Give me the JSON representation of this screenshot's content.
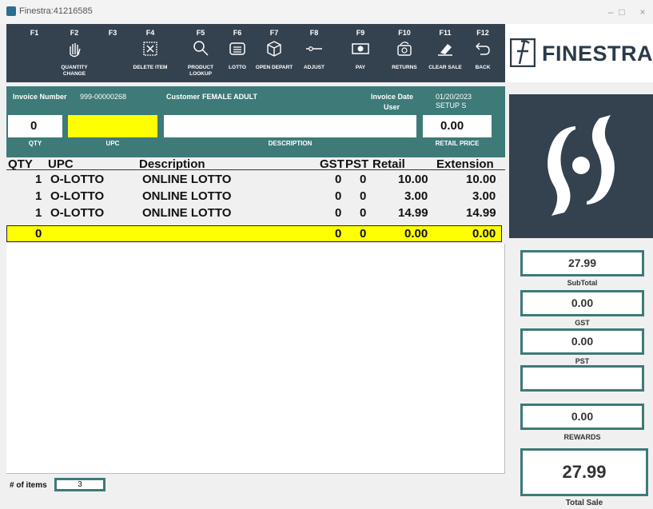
{
  "window": {
    "title": "Finestra:41216585",
    "minimize": "–",
    "maximize": "□",
    "close": "×"
  },
  "brand": {
    "name": "FINESTRA"
  },
  "toolbar": {
    "keys": [
      {
        "key": "F1",
        "label": "",
        "icon": "none"
      },
      {
        "key": "F2",
        "label": "QUANTITY CHANGE",
        "icon": "hand-icon"
      },
      {
        "key": "F3",
        "label": "",
        "icon": "none"
      },
      {
        "key": "F4",
        "label": "DELETE ITEM",
        "icon": "delete-box-icon"
      },
      {
        "key": "F5",
        "label": "PRODUCT LOOKUP",
        "icon": "search-icon"
      },
      {
        "key": "F6",
        "label": "LOTTO",
        "icon": "ticket-icon"
      },
      {
        "key": "F7",
        "label": "OPEN DEPART",
        "icon": "package-icon"
      },
      {
        "key": "F8",
        "label": "ADJUST",
        "icon": "adjust-icon"
      },
      {
        "key": "F9",
        "label": "PAY",
        "icon": "cash-icon"
      },
      {
        "key": "F10",
        "label": "RETURNS",
        "icon": "returns-icon"
      },
      {
        "key": "F11",
        "label": "CLEAR SALE",
        "icon": "eraser-icon"
      },
      {
        "key": "F12",
        "label": "BACK",
        "icon": "back-arrow-icon"
      }
    ]
  },
  "invoice": {
    "number_label": "Invoice Number",
    "number": "999-00000268",
    "customer_label": "Customer",
    "customer": "FEMALE ADULT",
    "date_label": "Invoice Date",
    "user_label": "User",
    "date": "01/20/2023",
    "user": "SETUP S",
    "qty_value": "0",
    "upc_value": "",
    "description_value": "",
    "price_value": "0.00",
    "qty_caption": "QTY",
    "upc_caption": "UPC",
    "description_caption": "DESCRIPTION",
    "price_caption": "RETAIL PRICE"
  },
  "table": {
    "headers": {
      "qty": "QTY",
      "upc": "UPC",
      "description": "Description",
      "gst": "GST",
      "pst": "PST",
      "retail": "Retail",
      "extension": "Extension"
    },
    "rows": [
      {
        "qty": "1",
        "upc": "O-LOTTO",
        "description": "ONLINE LOTTO",
        "gst": "0",
        "pst": "0",
        "retail": "10.00",
        "extension": "10.00"
      },
      {
        "qty": "1",
        "upc": "O-LOTTO",
        "description": "ONLINE LOTTO",
        "gst": "0",
        "pst": "0",
        "retail": "3.00",
        "extension": "3.00"
      },
      {
        "qty": "1",
        "upc": "O-LOTTO",
        "description": "ONLINE LOTTO",
        "gst": "0",
        "pst": "0",
        "retail": "14.99",
        "extension": "14.99"
      },
      {
        "qty": "0",
        "upc": "",
        "description": "",
        "gst": "0",
        "pst": "0",
        "retail": "0.00",
        "extension": "0.00"
      }
    ]
  },
  "footer": {
    "items_label": "# of items",
    "items_count": "3"
  },
  "totals": {
    "subtotal": "27.99",
    "subtotal_label": "SubTotal",
    "gst": "0.00",
    "gst_label": "GST",
    "pst": "0.00",
    "pst_label": "PST",
    "blank": "",
    "rewards": "0.00",
    "rewards_label": "REWARDS",
    "total": "27.99",
    "total_label": "Total Sale"
  },
  "colors": {
    "toolbar": "#34414f",
    "header": "#3d7a78",
    "highlight": "#ffff00",
    "logo_bg": "#34414f"
  }
}
